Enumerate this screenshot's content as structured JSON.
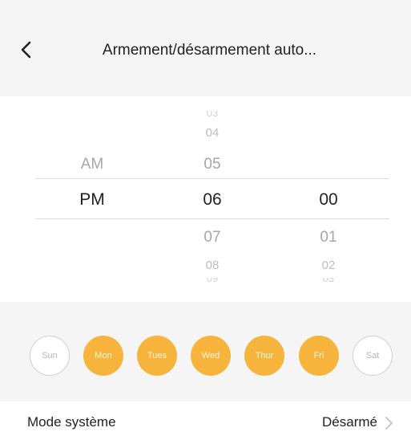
{
  "header": {
    "title": "Armement/désarmement auto...",
    "back_icon": "chevron-left-icon"
  },
  "picker": {
    "ampm": {
      "above": [
        "AM"
      ],
      "selected": "PM",
      "below": []
    },
    "hour": {
      "above": [
        "04",
        "05"
      ],
      "selected": "06",
      "below": [
        "07",
        "08"
      ]
    },
    "minute": {
      "above": [],
      "selected": "00",
      "below": [
        "01",
        "02"
      ]
    }
  },
  "days": [
    {
      "label": "Sun",
      "selected": false
    },
    {
      "label": "Mon",
      "selected": true
    },
    {
      "label": "Tues",
      "selected": true
    },
    {
      "label": "Wed",
      "selected": true
    },
    {
      "label": "Thur",
      "selected": true
    },
    {
      "label": "Fri",
      "selected": true
    },
    {
      "label": "Sat",
      "selected": false
    }
  ],
  "system_mode": {
    "label": "Mode système",
    "value": "Désarmé",
    "chevron_icon": "chevron-right-icon"
  },
  "colors": {
    "accent": "#f7b43c",
    "background": "#f5f5f5"
  }
}
